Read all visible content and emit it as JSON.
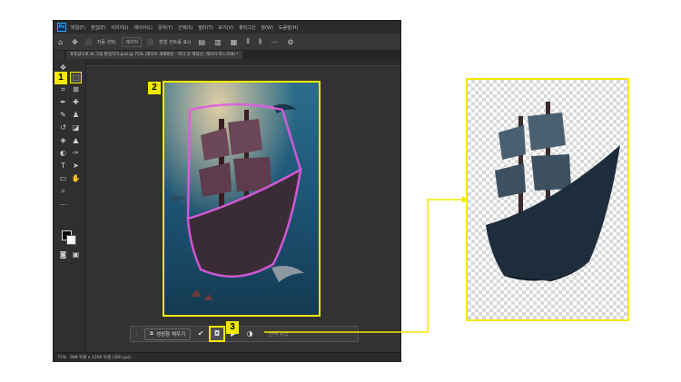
{
  "app": {
    "logo": "Ps",
    "menu": [
      "파일(F)",
      "편집(E)",
      "이미지(I)",
      "레이어(L)",
      "문자(Y)",
      "선택(S)",
      "필터(T)",
      "보기(V)",
      "플러그인",
      "창(W)",
      "도움말(H)"
    ]
  },
  "options": {
    "auto_select_label": "자동 선택:",
    "layer_select": "레이어",
    "transform_label": "변형 컨트롤 표시"
  },
  "document": {
    "tab_title": "포토샵으로 AI 그림 편집하기.psd @ 75% (레이어 개체화된 : 피다 밑 해적선, 레이어 마스크/8) *"
  },
  "statusbar": {
    "zoom": "75%",
    "size": "988 픽셀 x 1358 픽셀 (300 ppi)"
  },
  "context_bar": {
    "generative_fill_label": "생성형 채우기",
    "selection_label": "선택 취소"
  },
  "callouts": [
    "1",
    "2",
    "3"
  ],
  "colors": {
    "highlight": "#f3e900",
    "ui_dark": "#323232",
    "selection_glow": "#e05be0"
  }
}
